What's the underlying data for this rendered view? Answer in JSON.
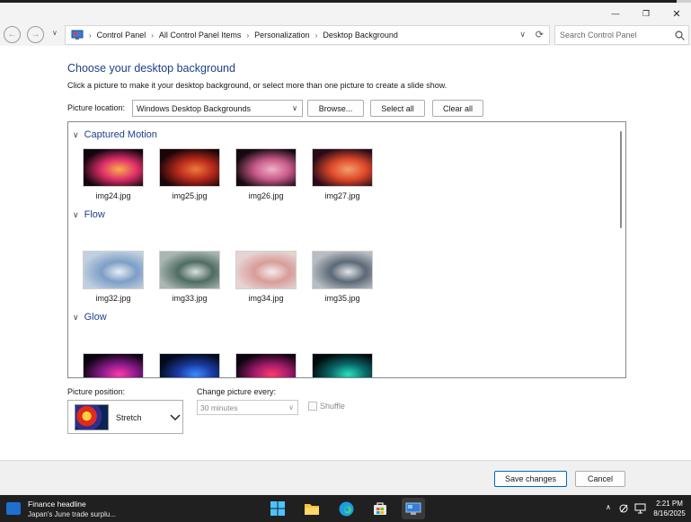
{
  "window": {
    "minimize_glyph": "—",
    "maximize_glyph": "❐",
    "close_glyph": "✕"
  },
  "address": {
    "breadcrumbs": [
      "Control Panel",
      "All Control Panel Items",
      "Personalization",
      "Desktop Background"
    ],
    "search_placeholder": "Search Control Panel"
  },
  "page": {
    "heading": "Choose your desktop background",
    "description": "Click a picture to make it your desktop background, or select more than one picture to create a slide show.",
    "location_label": "Picture location:",
    "location_value": "Windows Desktop Backgrounds",
    "browse_label": "Browse...",
    "select_all_label": "Select all",
    "clear_all_label": "Clear all"
  },
  "gallery": {
    "groups": [
      {
        "name": "Captured Motion",
        "images": [
          {
            "label": "img24.jpg",
            "colors": [
              "#12050f",
              "#e0306a",
              "#f7b04a"
            ]
          },
          {
            "label": "img25.jpg",
            "colors": [
              "#1a0508",
              "#b82a1c",
              "#f07a3a"
            ]
          },
          {
            "label": "img26.jpg",
            "colors": [
              "#160a10",
              "#c85a8a",
              "#f0b2c8"
            ]
          },
          {
            "label": "img27.jpg",
            "colors": [
              "#2a0b1a",
              "#e04a2a",
              "#f2a06a"
            ]
          }
        ]
      },
      {
        "name": "Flow",
        "images": [
          {
            "label": "img32.jpg",
            "colors": [
              "#bfd0e0",
              "#7d9ec6",
              "#e8eef6"
            ]
          },
          {
            "label": "img33.jpg",
            "colors": [
              "#a9b6b2",
              "#4f6b62",
              "#d9e2dd"
            ]
          },
          {
            "label": "img34.jpg",
            "colors": [
              "#e6d4d2",
              "#d89c9a",
              "#f4ecea"
            ]
          },
          {
            "label": "img35.jpg",
            "colors": [
              "#b8bdc4",
              "#5c6876",
              "#e2e5ea"
            ]
          }
        ]
      },
      {
        "name": "Glow",
        "images": [
          {
            "label": "",
            "colors": [
              "#0a0410",
              "#8a1a8a",
              "#ff3aa8"
            ]
          },
          {
            "label": "",
            "colors": [
              "#030a1a",
              "#1a3aa0",
              "#3a8aff"
            ]
          },
          {
            "label": "",
            "colors": [
              "#0c0410",
              "#a01a6a",
              "#ff3a6a"
            ]
          },
          {
            "label": "",
            "colors": [
              "#030a0c",
              "#0a6a6a",
              "#2ae0c0"
            ]
          }
        ]
      }
    ]
  },
  "options": {
    "position_label": "Picture position:",
    "position_value": "Stretch",
    "interval_label": "Change picture every:",
    "interval_value": "30 minutes",
    "shuffle_label": "Shuffle"
  },
  "footer": {
    "save_label": "Save changes",
    "cancel_label": "Cancel"
  },
  "taskbar": {
    "news_title": "Finance headline",
    "news_subtitle": "Japan's June trade surplu...",
    "time": "2:21 PM",
    "date": "8/16/2025"
  }
}
